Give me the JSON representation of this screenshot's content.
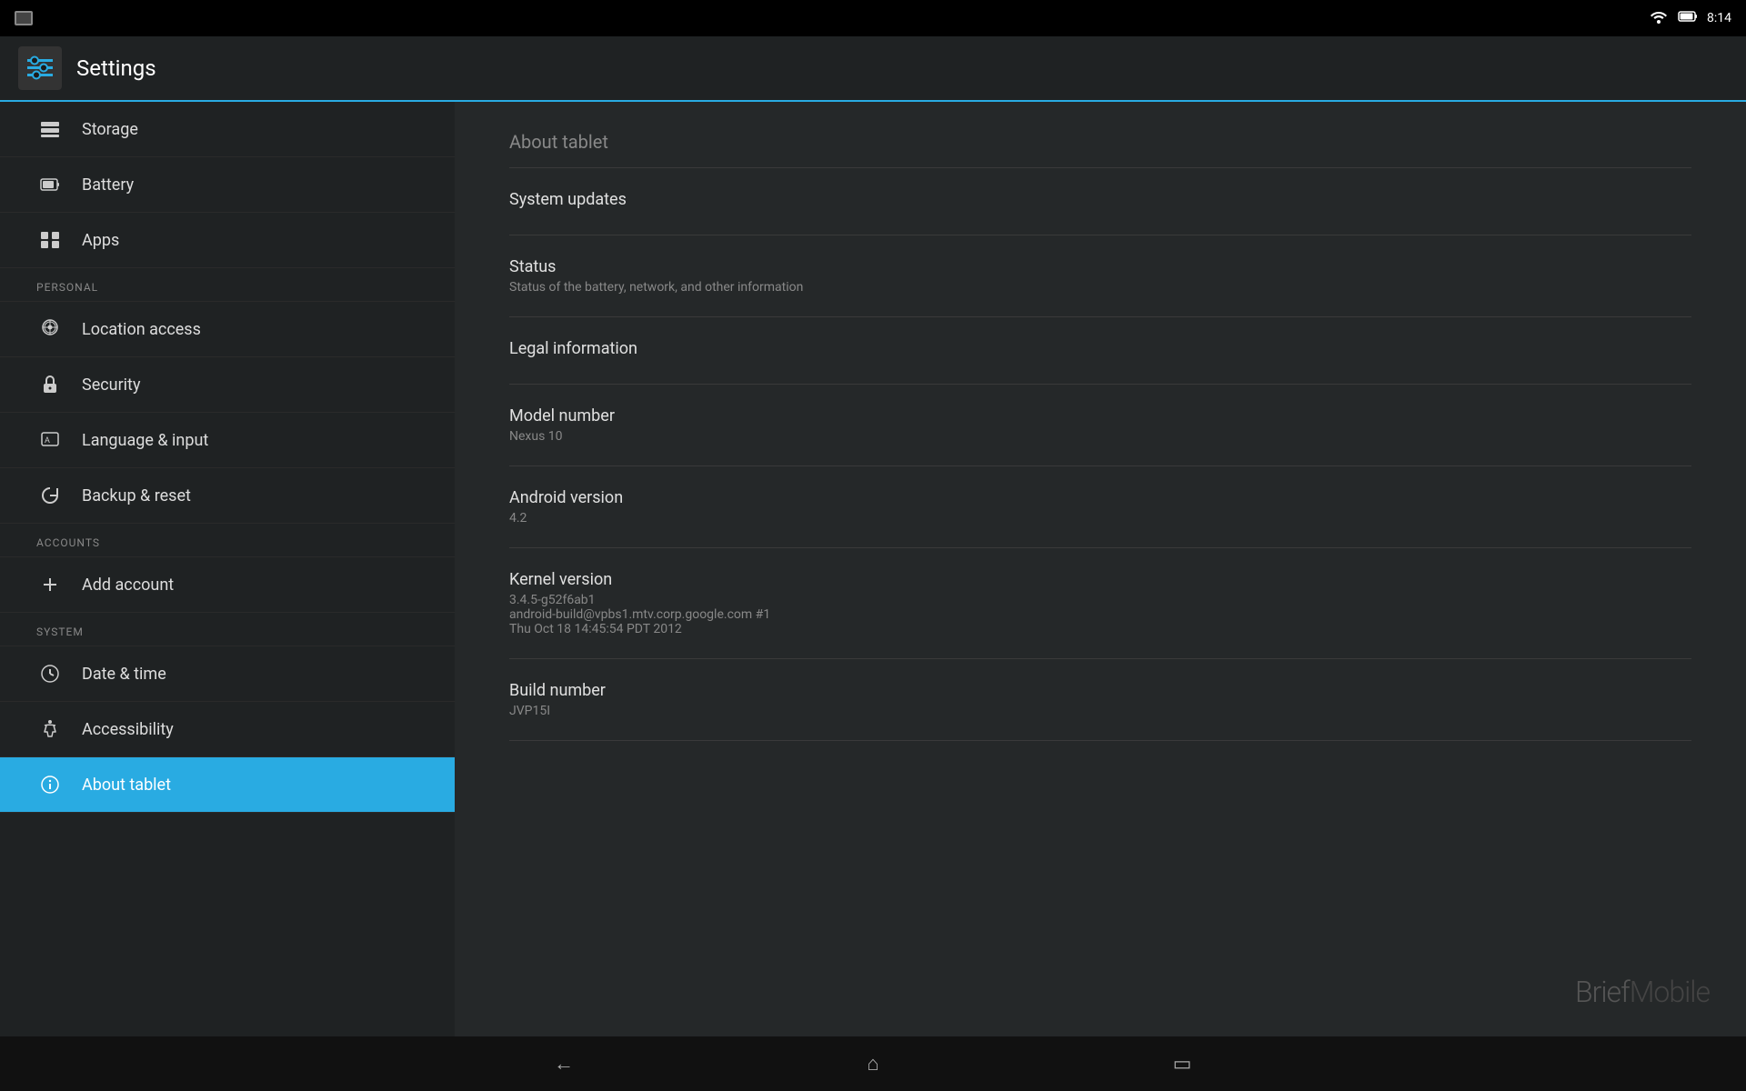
{
  "statusBar": {
    "time": "8:14",
    "wifiIcon": "wifi",
    "batteryIcon": "battery"
  },
  "titleBar": {
    "appName": "Settings"
  },
  "sidebar": {
    "deviceSection": {
      "items": [
        {
          "id": "storage",
          "label": "Storage",
          "icon": "storage"
        },
        {
          "id": "battery",
          "label": "Battery",
          "icon": "battery"
        },
        {
          "id": "apps",
          "label": "Apps",
          "icon": "apps"
        }
      ]
    },
    "personalSection": {
      "header": "PERSONAL",
      "items": [
        {
          "id": "location",
          "label": "Location access",
          "icon": "location"
        },
        {
          "id": "security",
          "label": "Security",
          "icon": "security"
        },
        {
          "id": "language",
          "label": "Language & input",
          "icon": "language"
        },
        {
          "id": "backup",
          "label": "Backup & reset",
          "icon": "backup"
        }
      ]
    },
    "accountsSection": {
      "header": "ACCOUNTS",
      "items": [
        {
          "id": "addaccount",
          "label": "Add account",
          "icon": "add"
        }
      ]
    },
    "systemSection": {
      "header": "SYSTEM",
      "items": [
        {
          "id": "datetime",
          "label": "Date & time",
          "icon": "datetime"
        },
        {
          "id": "accessibility",
          "label": "Accessibility",
          "icon": "accessibility"
        },
        {
          "id": "about",
          "label": "About tablet",
          "icon": "about",
          "active": true
        }
      ]
    }
  },
  "content": {
    "title": "About tablet",
    "items": [
      {
        "id": "systemupdates",
        "title": "System updates",
        "subtitle": ""
      },
      {
        "id": "status",
        "title": "Status",
        "subtitle": "Status of the battery, network, and other information"
      },
      {
        "id": "legalinfo",
        "title": "Legal information",
        "subtitle": ""
      },
      {
        "id": "modelnumber",
        "title": "Model number",
        "subtitle": "Nexus 10"
      },
      {
        "id": "androidversion",
        "title": "Android version",
        "subtitle": "4.2"
      },
      {
        "id": "kernelversion",
        "title": "Kernel version",
        "subtitle": "3.4.5-g52f6ab1\nandroid-build@vpbs1.mtv.corp.google.com #1\nThu Oct 18 14:45:54 PDT 2012"
      },
      {
        "id": "buildnumber",
        "title": "Build number",
        "subtitle": "JVP15I"
      }
    ]
  },
  "watermark": {
    "brief": "Brief",
    "mobile": "Mobile"
  },
  "navBar": {
    "backIcon": "←",
    "homeIcon": "⌂",
    "recentIcon": "▭"
  }
}
